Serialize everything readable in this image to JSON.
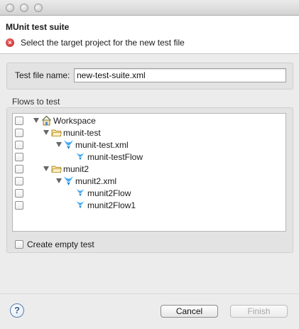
{
  "window": {
    "title": "MUnit test suite"
  },
  "header": {
    "title": "MUnit test suite",
    "message": "Select the target project for the new test file",
    "status_icon": "error-icon"
  },
  "form": {
    "test_file_label": "Test file name:",
    "test_file_value": "new-test-suite.xml"
  },
  "flows": {
    "section_label": "Flows to test",
    "tree": [
      {
        "label": "Workspace",
        "icon": "workspace-icon",
        "expanded": true
      },
      {
        "label": "munit-test",
        "icon": "folder-icon",
        "expanded": true
      },
      {
        "label": "munit-test.xml",
        "icon": "mule-config-icon",
        "expanded": true
      },
      {
        "label": "munit-testFlow",
        "icon": "flow-icon"
      },
      {
        "label": "munit2",
        "icon": "folder-icon",
        "expanded": true
      },
      {
        "label": "munit2.xml",
        "icon": "mule-config-icon",
        "expanded": true
      },
      {
        "label": "munit2Flow",
        "icon": "flow-icon"
      },
      {
        "label": "munit2Flow1",
        "icon": "flow-icon"
      }
    ]
  },
  "options": {
    "create_empty_label": "Create empty test"
  },
  "buttons": {
    "help_icon": "help-icon",
    "cancel_label": "Cancel",
    "finish_label": "Finish"
  },
  "colors": {
    "error": "#c02424",
    "help": "#5a7fae",
    "mule_blue": "#3fa9f5"
  }
}
